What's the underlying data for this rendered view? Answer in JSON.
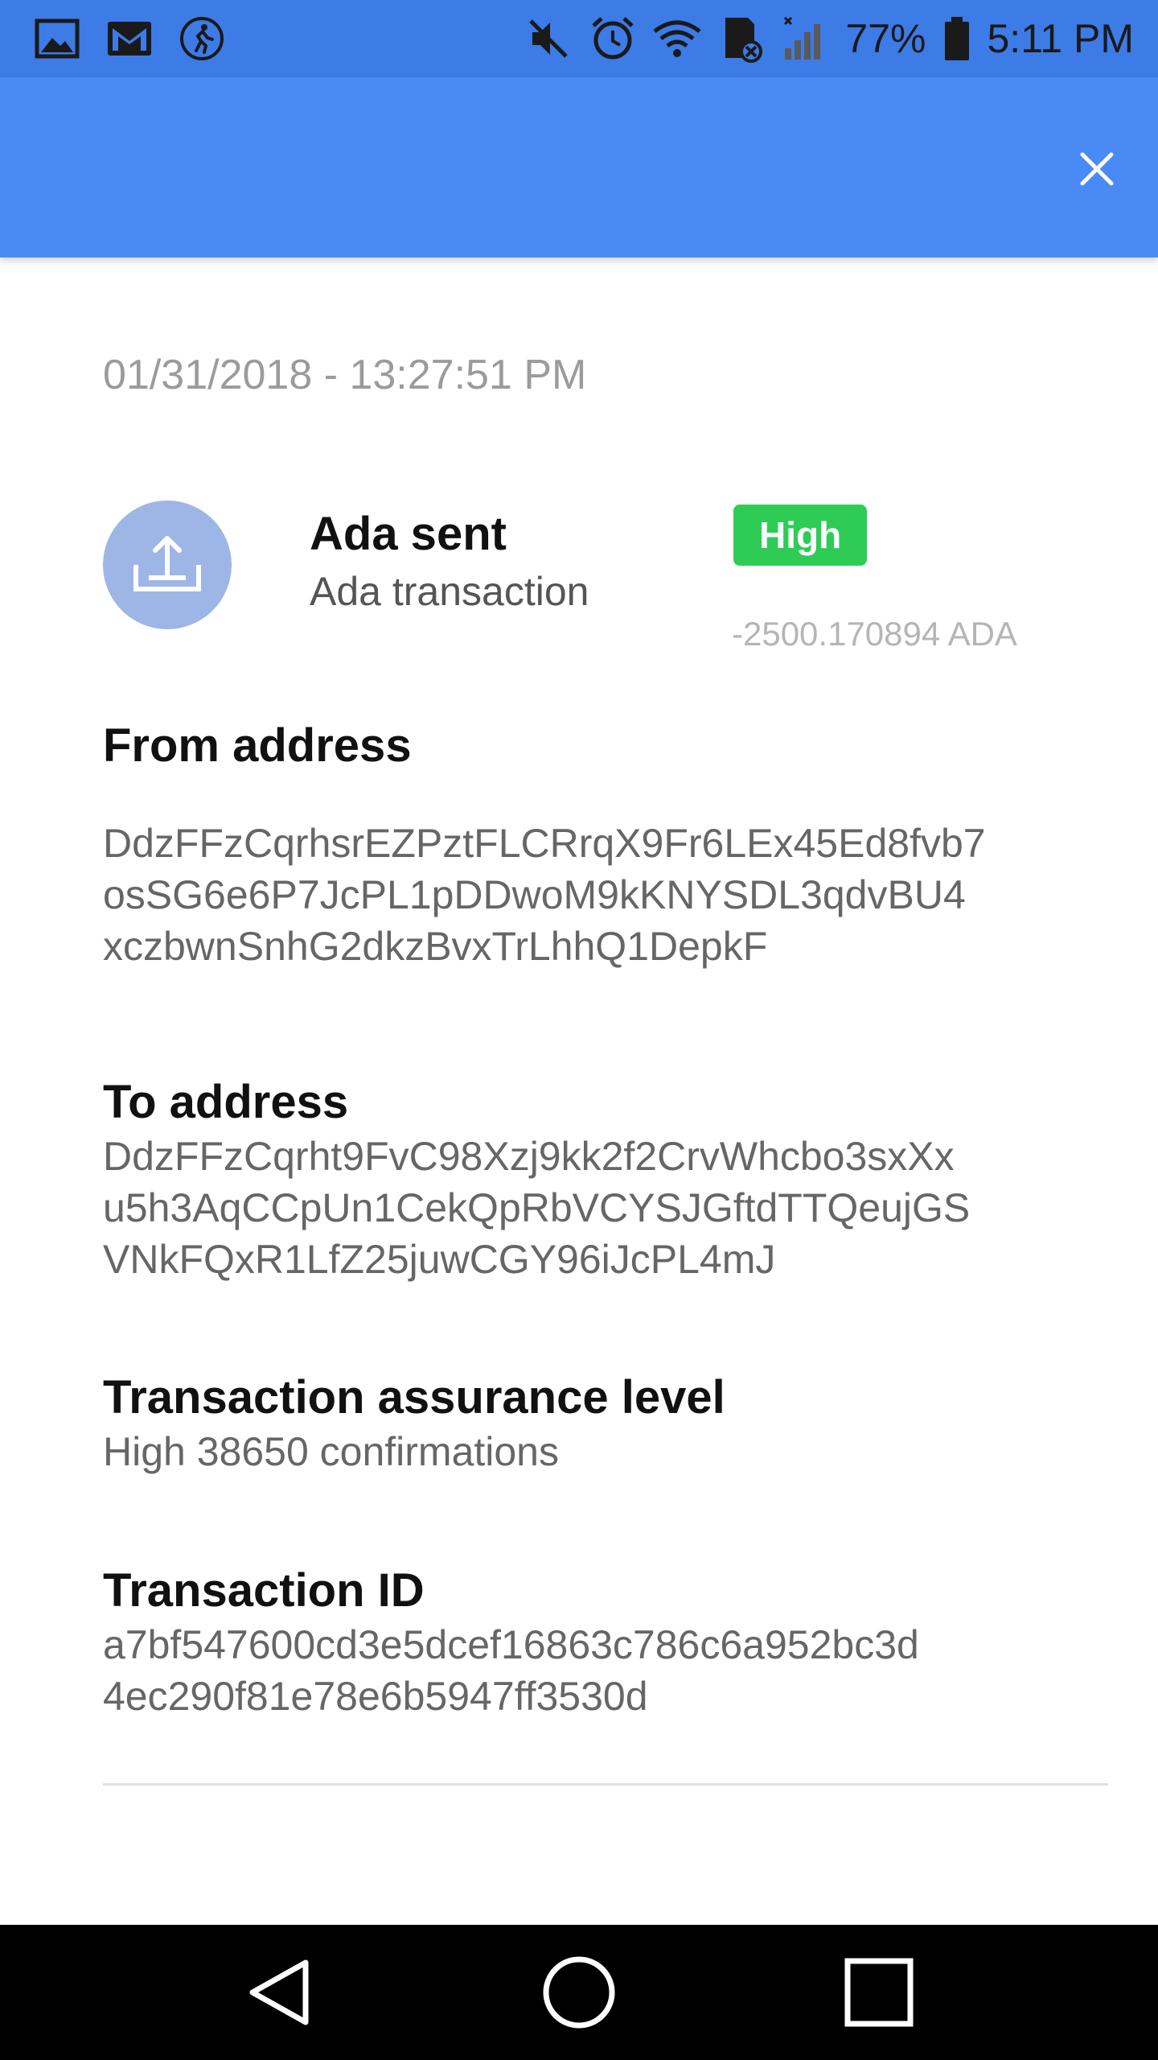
{
  "status_bar": {
    "battery_percent": "77%",
    "time": "5:11 PM",
    "left_icons": [
      "gallery-icon",
      "gmail-icon",
      "fitness-icon"
    ],
    "right_icons": [
      "mute-icon",
      "alarm-icon",
      "wifi-icon",
      "sd-card-icon",
      "signal-icon",
      "battery-icon"
    ]
  },
  "header": {
    "background": "#4a8af4",
    "close_icon": "close-icon"
  },
  "transaction": {
    "timestamp": "01/31/2018 - 13:27:51 PM",
    "icon": "upload-icon",
    "title": "Ada sent",
    "subtitle": "Ada transaction",
    "badge": "High",
    "badge_color": "#2ecc55",
    "amount": "-2500.170894 ADA"
  },
  "sections": {
    "from": {
      "title": "From address",
      "lines": [
        "DdzFFzCqrhsrEZPztFLCRrqX9Fr6LEx45Ed8fvb7",
        "osSG6e6P7JcPL1pDDwoM9kKNYSDL3qdvBU4",
        "xczbwnSnhG2dkzBvxTrLhhQ1DepkF"
      ]
    },
    "to": {
      "title": "To address",
      "lines": [
        "DdzFFzCqrht9FvC98Xzj9kk2f2CrvWhcbo3sxXx",
        "u5h3AqCCpUn1CekQpRbVCYSJGftdTTQeujGS",
        "VNkFQxR1LfZ25juwCGY96iJcPL4mJ"
      ]
    },
    "assurance": {
      "title": "Transaction assurance level",
      "value": "High 38650 confirmations"
    },
    "tx_id": {
      "title": "Transaction ID",
      "lines": [
        "a7bf547600cd3e5dcef16863c786c6a952bc3d",
        "4ec290f81e78e6b5947ff3530d"
      ]
    }
  },
  "nav_bar": {
    "icons": [
      "back-icon",
      "home-icon",
      "recents-icon"
    ]
  }
}
